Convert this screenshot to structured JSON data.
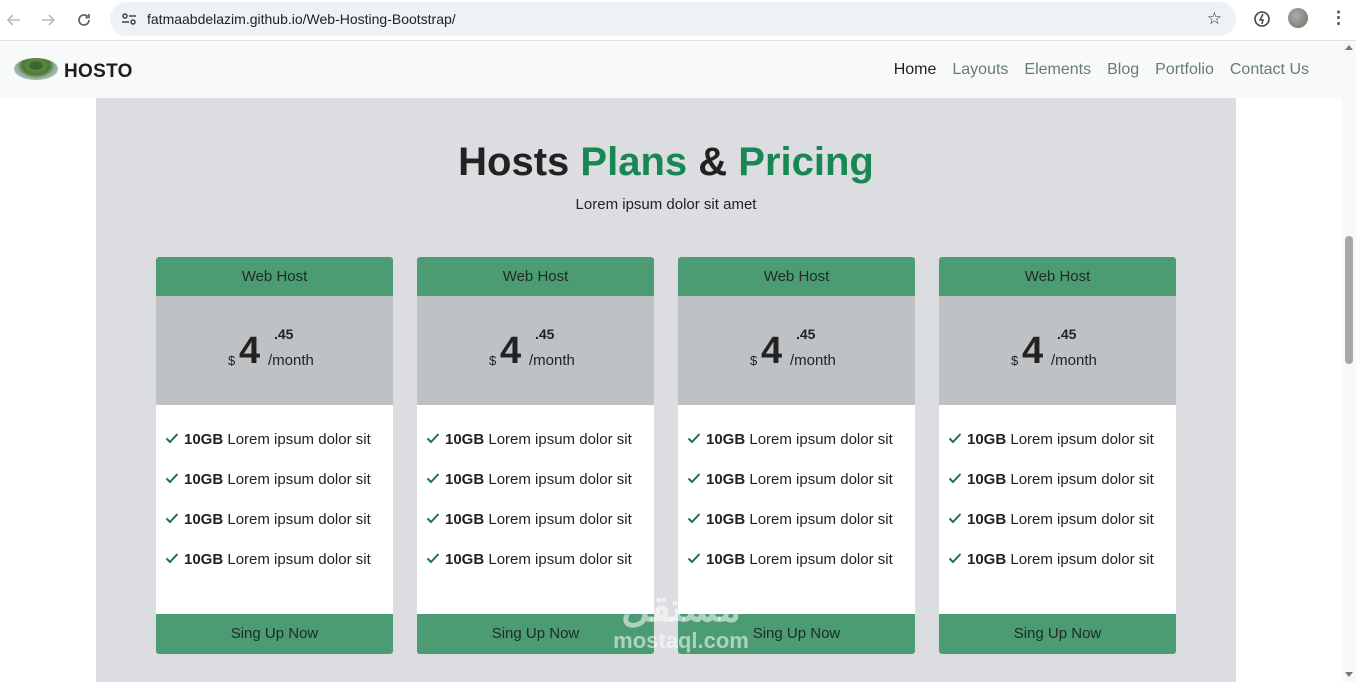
{
  "browser": {
    "url": "fatmaabdelazim.github.io/Web-Hosting-Bootstrap/"
  },
  "navbar": {
    "brand": "HOSTO",
    "links": [
      "Home",
      "Layouts",
      "Elements",
      "Blog",
      "Portfolio",
      "Contact Us"
    ],
    "active_index": 0
  },
  "pricing": {
    "title_part1": "Hosts",
    "title_part2": "Plans",
    "title_part3": "&",
    "title_part4": "Pricing",
    "subtitle": "Lorem ipsum dolor sit amet",
    "plans": [
      {
        "name": "Web Host",
        "currency": "$",
        "price": "4",
        "cents": ".45",
        "period": "/month",
        "features": [
          {
            "strong": "10GB",
            "text": "Lorem ipsum dolor sit"
          },
          {
            "strong": "10GB",
            "text": "Lorem ipsum dolor sit"
          },
          {
            "strong": "10GB",
            "text": "Lorem ipsum dolor sit"
          },
          {
            "strong": "10GB",
            "text": "Lorem ipsum dolor sit"
          }
        ],
        "cta": "Sing Up Now"
      },
      {
        "name": "Web Host",
        "currency": "$",
        "price": "4",
        "cents": ".45",
        "period": "/month",
        "features": [
          {
            "strong": "10GB",
            "text": "Lorem ipsum dolor sit"
          },
          {
            "strong": "10GB",
            "text": "Lorem ipsum dolor sit"
          },
          {
            "strong": "10GB",
            "text": "Lorem ipsum dolor sit"
          },
          {
            "strong": "10GB",
            "text": "Lorem ipsum dolor sit"
          }
        ],
        "cta": "Sing Up Now"
      },
      {
        "name": "Web Host",
        "currency": "$",
        "price": "4",
        "cents": ".45",
        "period": "/month",
        "features": [
          {
            "strong": "10GB",
            "text": "Lorem ipsum dolor sit"
          },
          {
            "strong": "10GB",
            "text": "Lorem ipsum dolor sit"
          },
          {
            "strong": "10GB",
            "text": "Lorem ipsum dolor sit"
          },
          {
            "strong": "10GB",
            "text": "Lorem ipsum dolor sit"
          }
        ],
        "cta": "Sing Up Now"
      },
      {
        "name": "Web Host",
        "currency": "$",
        "price": "4",
        "cents": ".45",
        "period": "/month",
        "features": [
          {
            "strong": "10GB",
            "text": "Lorem ipsum dolor sit"
          },
          {
            "strong": "10GB",
            "text": "Lorem ipsum dolor sit"
          },
          {
            "strong": "10GB",
            "text": "Lorem ipsum dolor sit"
          },
          {
            "strong": "10GB",
            "text": "Lorem ipsum dolor sit"
          }
        ],
        "cta": "Sing Up Now"
      }
    ]
  },
  "watermark": {
    "arabic": "مستقل",
    "latin": "mostaql.com"
  },
  "colors": {
    "accent_green": "#198754",
    "card_header": "#4b9c73",
    "section_bg": "#dcdde0",
    "price_bg": "#bfc2c5",
    "nav_link": "#64806b"
  }
}
